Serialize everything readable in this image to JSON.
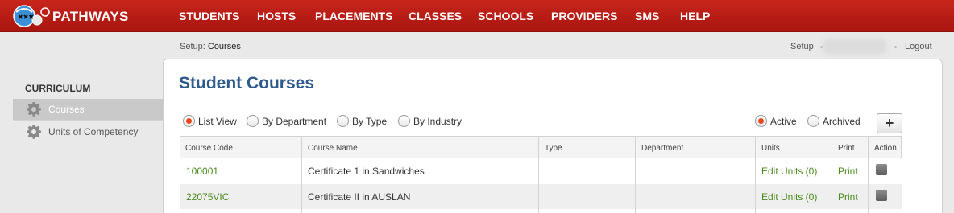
{
  "brand": "PATHWAYS",
  "nav": [
    "STUDENTS",
    "HOSTS",
    "PLACEMENTS",
    "CLASSES",
    "SCHOOLS",
    "PROVIDERS",
    "SMS",
    "HELP"
  ],
  "breadcrumb": {
    "prefix": "Setup:",
    "current": "Courses"
  },
  "userbar": {
    "setup": "Setup",
    "logout": "Logout"
  },
  "sidebar": {
    "title": "CURRICULUM",
    "items": [
      {
        "label": "Courses",
        "active": true
      },
      {
        "label": "Units of Competency",
        "active": false
      }
    ]
  },
  "page_title": "Student Courses",
  "view_options": [
    "List View",
    "By Department",
    "By Type",
    "By Industry"
  ],
  "selected_view": "List View",
  "status_options": [
    "Active",
    "Archived"
  ],
  "selected_status": "Active",
  "add_label": "+",
  "table": {
    "headers": [
      "Course Code",
      "Course Name",
      "Type",
      "Department",
      "Units",
      "Print",
      "Action"
    ],
    "rows": [
      {
        "code": "100001",
        "name": "Certificate 1 in Sandwiches",
        "type": "",
        "department": "",
        "units": "Edit Units (0)",
        "print": "Print"
      },
      {
        "code": "22075VIC",
        "name": "Certificate II in AUSLAN",
        "type": "",
        "department": "",
        "units": "Edit Units (0)",
        "print": "Print"
      }
    ]
  },
  "colors": {
    "topbar": "#b81d15",
    "title": "#2f5a8c",
    "link": "#4b8a1f",
    "radio_on": "#e8471a"
  }
}
